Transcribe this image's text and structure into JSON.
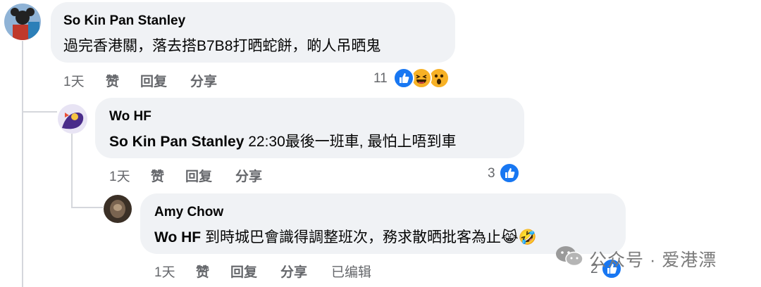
{
  "comments": [
    {
      "author": "So Kin Pan Stanley",
      "text": "過完香港關，落去搭B7B8打晒蛇餅，啲人吊晒鬼",
      "time": "1天",
      "like_label": "赞",
      "reply_label": "回复",
      "share_label": "分享",
      "reaction_count": "11",
      "reactions": [
        "like-icon",
        "haha-icon",
        "wow-icon"
      ]
    },
    {
      "author": "Wo HF",
      "mention": "So Kin Pan Stanley",
      "text": " 22:30最後一班車, 最怕上唔到車",
      "time": "1天",
      "like_label": "赞",
      "reply_label": "回复",
      "share_label": "分享",
      "reaction_count": "3",
      "reactions": [
        "like-icon"
      ]
    },
    {
      "author": "Amy Chow",
      "mention": "Wo HF",
      "text": " 到時城巴會識得調整班次，務求散晒批客為止",
      "trailing_emojis": "😹🤣",
      "time": "1天",
      "like_label": "赞",
      "reply_label": "回复",
      "share_label": "分享",
      "edited_label": "已编辑",
      "reaction_count": "2",
      "reactions": [
        "like-icon"
      ]
    }
  ],
  "watermark": {
    "text": "公众号 · 爱港漂"
  },
  "colors": {
    "bubble": "#f0f2f5",
    "like": "#1877f2",
    "meta": "#65676b"
  }
}
